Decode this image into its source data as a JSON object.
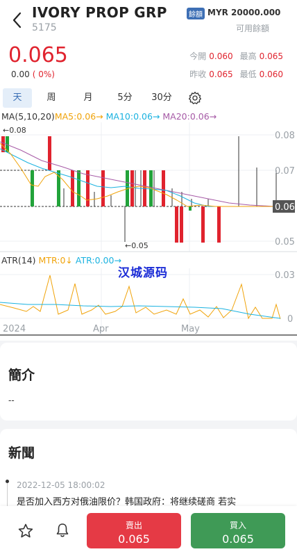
{
  "header": {
    "title": "IVORY PROP GRP",
    "code": "5175",
    "balance_tag": "餘額",
    "balance_value": "MYR 20000.000",
    "available_label": "可用餘額"
  },
  "quote": {
    "price": "0.065",
    "change": "0.00",
    "change_pct": "( 0%)",
    "open_label": "今開",
    "open": "0.060",
    "high_label": "最高",
    "high": "0.065",
    "prev_close_label": "昨收",
    "prev_close": "0.065",
    "low_label": "最低",
    "low": "0.060"
  },
  "tabs": [
    "天",
    "周",
    "月",
    "5分",
    "30分"
  ],
  "active_tab": "天",
  "legend": {
    "ma": "MA(5,10,20)",
    "ma5": "MA5:0.06→",
    "ma10": "MA10:0.06→",
    "ma20": "MA20:0.06→",
    "atr": "ATR(14)",
    "mtr": "MTR:0↓",
    "atr_val": "ATR:0.00→"
  },
  "colors": {
    "up": "#e0232e",
    "down": "#22a33a",
    "ma5": "#f0a30a",
    "ma10": "#1ab2e0",
    "ma20": "#a65aa6",
    "accent": "#3b6fb5"
  },
  "watermark": "汉城源码",
  "chart_data": {
    "type": "candlestick",
    "y_ticks": [
      "0.08",
      "0.07",
      "0.06",
      "0.05"
    ],
    "current_label": "0.06",
    "max_label": "←0.08",
    "min_label": "←0.05",
    "x_labels": [
      "2024",
      "Apr",
      "May"
    ],
    "atr_ticks": [
      "0.03",
      "0"
    ]
  },
  "sections": {
    "intro_title": "簡介",
    "intro_text": "--",
    "news_title": "新聞",
    "news": [
      {
        "time": "2022-12-05 18:00:02",
        "headline": "是否加入西方对俄油限价？韩国政府：将继续磋商 若实"
      }
    ]
  },
  "actions": {
    "sell_label": "賣出",
    "sell_price": "0.065",
    "buy_label": "買入",
    "buy_price": "0.065"
  }
}
